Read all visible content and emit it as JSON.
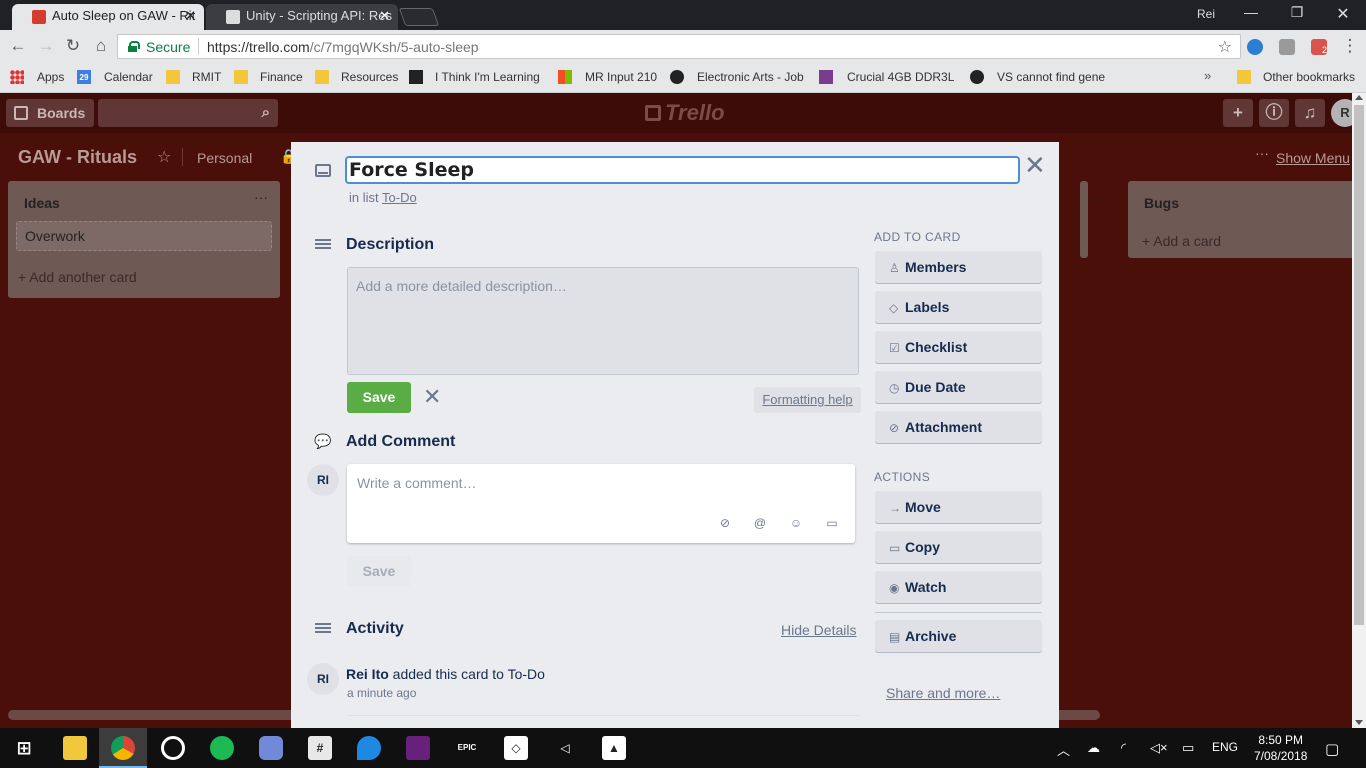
{
  "browser": {
    "tabs": [
      {
        "title": "Auto Sleep on GAW - Rit",
        "active": true
      },
      {
        "title": "Unity - Scripting API: Res",
        "active": false
      }
    ],
    "profile": "Rei",
    "address": {
      "secure_label": "Secure",
      "url_host": "https://trello.com",
      "url_path": "/c/7mgqWKsh/5-auto-sleep"
    },
    "extension_badge": "2",
    "bookmarks": [
      {
        "label": "Apps",
        "icon": "apps-grid-icon"
      },
      {
        "label": "Calendar",
        "icon": "calendar-icon"
      },
      {
        "label": "RMIT",
        "icon": "folder-icon"
      },
      {
        "label": "Finance",
        "icon": "folder-icon"
      },
      {
        "label": "Resources",
        "icon": "folder-icon"
      },
      {
        "label": "I Think I'm Learning",
        "icon": "trello-icon"
      },
      {
        "label": "MR Input 210",
        "icon": "microsoft-icon"
      },
      {
        "label": "Electronic Arts - Job",
        "icon": "ea-icon"
      },
      {
        "label": "Crucial 4GB DDR3L",
        "icon": "shop-icon"
      },
      {
        "label": "VS cannot find gene",
        "icon": "unity-icon"
      }
    ],
    "calendar_day": "29",
    "other_bookmarks": "Other bookmarks"
  },
  "trello": {
    "header": {
      "boards_label": "Boards",
      "logo_text": "Trello",
      "avatar_initial": "R"
    },
    "board": {
      "title": "GAW - Rituals",
      "team": "Personal",
      "show_menu": "Show Menu"
    },
    "lists": [
      {
        "name": "Ideas",
        "cards": [
          "Overwork"
        ],
        "add_label": "+ Add another card"
      },
      {
        "name": "Bugs",
        "cards": [],
        "add_label": "+ Add a card"
      }
    ]
  },
  "card": {
    "title": "Force Sleep",
    "in_list_prefix": "in list",
    "list_name": "To-Do",
    "description": {
      "heading": "Description",
      "placeholder": "Add a more detailed description…",
      "save": "Save",
      "formatting_help": "Formatting help"
    },
    "comment": {
      "heading": "Add Comment",
      "avatar": "RI",
      "placeholder": "Write a comment…",
      "save": "Save"
    },
    "activity": {
      "heading": "Activity",
      "hide_details": "Hide Details",
      "entries": [
        {
          "avatar": "RI",
          "user": "Rei Ito",
          "text": "added this card to To-Do",
          "time": "a minute ago"
        }
      ]
    },
    "sidebar": {
      "add_heading": "ADD TO CARD",
      "add_buttons": [
        {
          "label": "Members",
          "icon": "person-icon"
        },
        {
          "label": "Labels",
          "icon": "tag-icon"
        },
        {
          "label": "Checklist",
          "icon": "checkbox-icon"
        },
        {
          "label": "Due Date",
          "icon": "clock-icon"
        },
        {
          "label": "Attachment",
          "icon": "paperclip-icon"
        }
      ],
      "actions_heading": "ACTIONS",
      "action_buttons": [
        {
          "label": "Move",
          "icon": "arrow-right-icon"
        },
        {
          "label": "Copy",
          "icon": "card-icon"
        },
        {
          "label": "Watch",
          "icon": "eye-icon"
        }
      ],
      "archive": "Archive",
      "share": "Share and more…"
    }
  },
  "taskbar": {
    "language": "ENG",
    "time": "8:50 PM",
    "date": "7/08/2018"
  },
  "colors": {
    "board_bg": "#4a0f09",
    "save_green": "#5aac44",
    "modal_bg": "#ebecf0"
  }
}
